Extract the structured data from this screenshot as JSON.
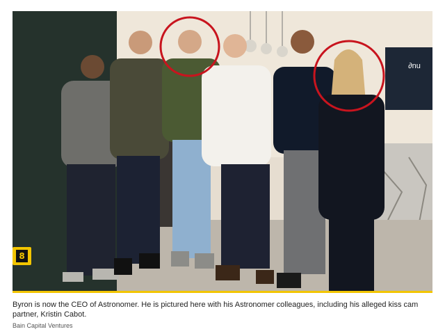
{
  "caption": {
    "text": "Byron is now the CEO of Astronomer. He is pictured here with his Astronomer colleagues, including his alleged kiss cam partner, Kristin Cabot.",
    "credit": "Bain Capital Ventures"
  },
  "photo": {
    "badge_label": "8",
    "wall_logo_text": "∂nu",
    "highlight_color": "#c8141e",
    "accent_color": "#f2c500"
  }
}
